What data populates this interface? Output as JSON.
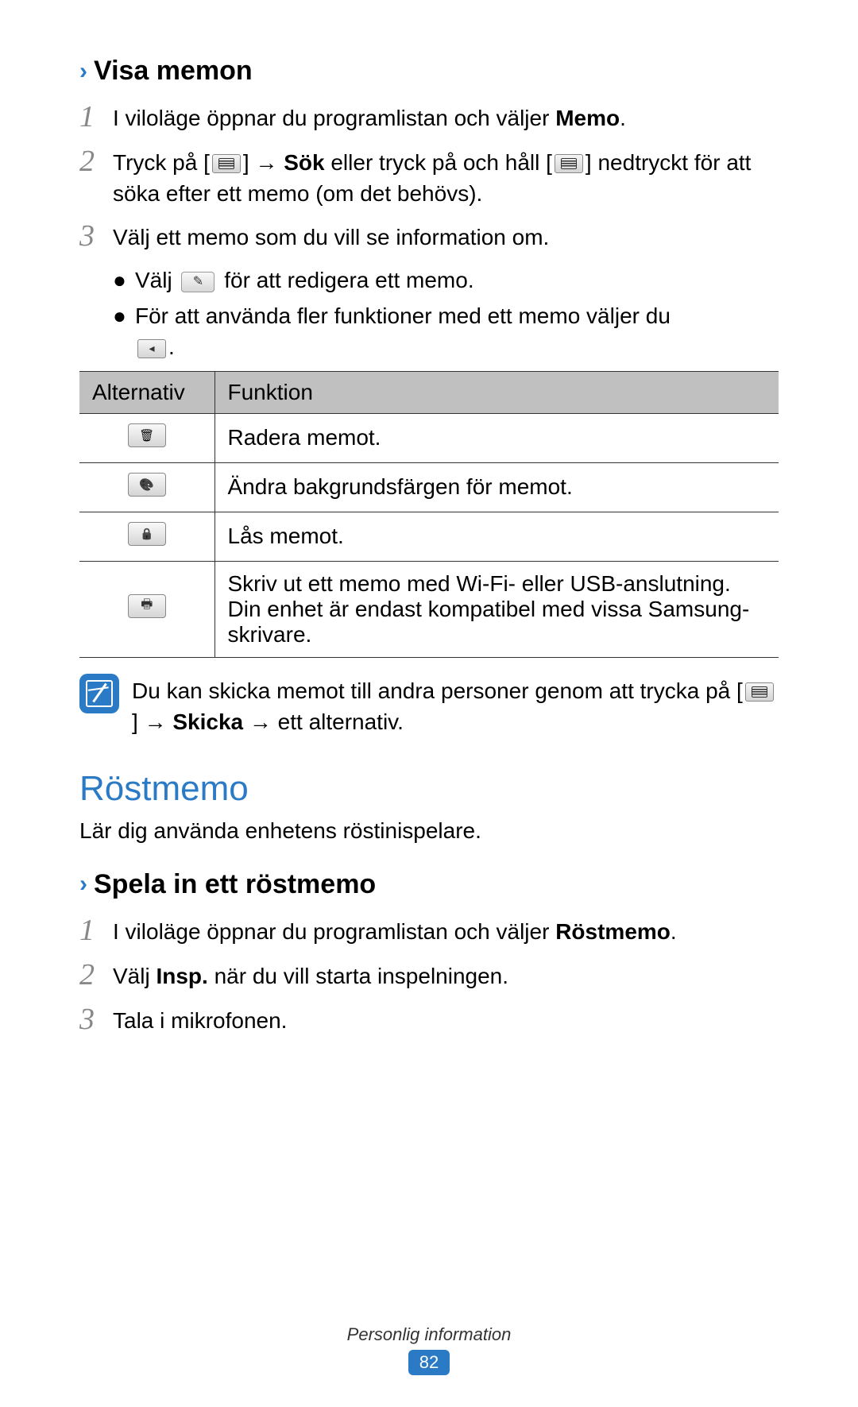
{
  "section1": {
    "title": "Visa memon",
    "steps": {
      "s1": {
        "num": "1",
        "pre": "I viloläge öppnar du programlistan och väljer ",
        "bold": "Memo",
        "post": "."
      },
      "s2": {
        "num": "2",
        "pre": "Tryck på [",
        "mid1": "] → ",
        "bold": "Sök",
        "mid2": " eller tryck på och håll [",
        "post": "] nedtryckt för att söka efter ett memo (om det behövs)."
      },
      "s3": {
        "num": "3",
        "text": "Välj ett memo som du vill se information om."
      }
    },
    "bullets": {
      "b1": {
        "pre": "Välj ",
        "post": " för att redigera ett memo."
      },
      "b2": {
        "pre": "För att använda fler funktioner med ett memo väljer du ",
        "post": "."
      }
    },
    "table": {
      "h1": "Alternativ",
      "h2": "Funktion",
      "r1": "Radera memot.",
      "r2": "Ändra bakgrundsfärgen för memot.",
      "r3": "Lås memot.",
      "r4": "Skriv ut ett memo med Wi-Fi- eller USB-anslutning. Din enhet är endast kompatibel med vissa Samsung-skrivare."
    },
    "note": {
      "pre": "Du kan skicka memot till andra personer genom att trycka på [",
      "mid": "] → ",
      "bold": "Skicka",
      "post": " → ett alternativ."
    }
  },
  "section2": {
    "title": "Röstmemo",
    "intro": "Lär dig använda enhetens röstinispelare.",
    "sub_title": "Spela in ett röstmemo",
    "steps": {
      "s1": {
        "num": "1",
        "pre": "I viloläge öppnar du programlistan och väljer ",
        "bold": "Röstmemo",
        "post": "."
      },
      "s2": {
        "num": "2",
        "pre": "Välj ",
        "bold": "Insp.",
        "post": " när du vill starta inspelningen."
      },
      "s3": {
        "num": "3",
        "text": "Tala i mikrofonen."
      }
    }
  },
  "footer": {
    "text": "Personlig information",
    "page": "82"
  }
}
